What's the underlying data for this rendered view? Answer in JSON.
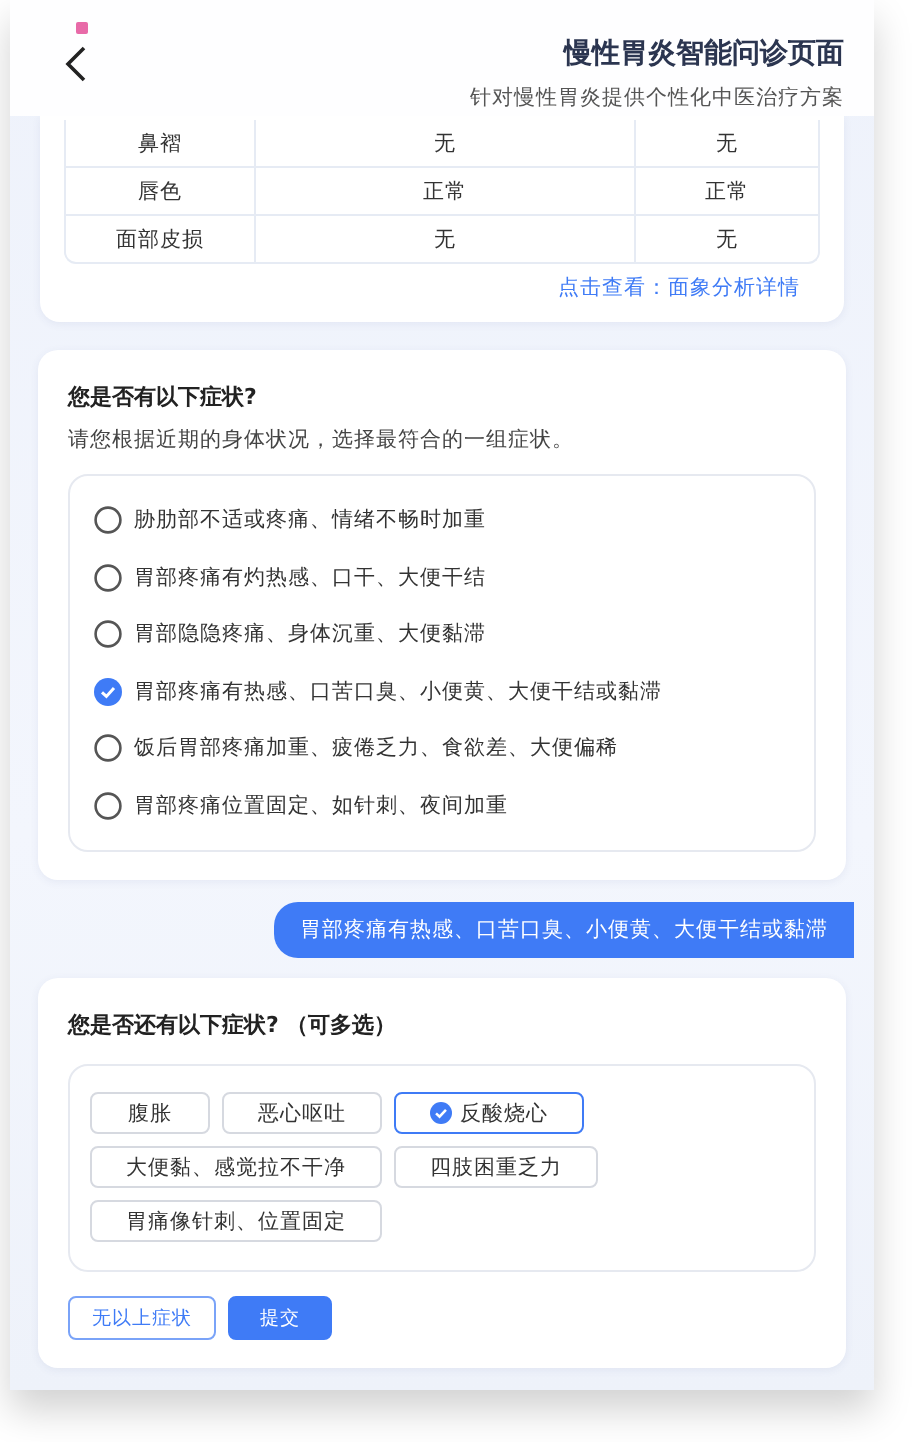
{
  "header": {
    "title": "慢性胃炎智能问诊页面",
    "subtitle": "针对慢性胃炎提供个性化中医治疗方案"
  },
  "face_table": {
    "rows": [
      [
        "鼻褶",
        "无",
        "无"
      ],
      [
        "唇色",
        "正常",
        "正常"
      ],
      [
        "面部皮损",
        "无",
        "无"
      ]
    ],
    "link": "点击查看：面象分析详情"
  },
  "question": {
    "title": "您是否有以下症状?",
    "hint": "请您根据近期的身体状况，选择最符合的一组症状。",
    "options": [
      {
        "label": "胁肋部不适或疼痛、情绪不畅时加重",
        "selected": false
      },
      {
        "label": "胃部疼痛有灼热感、口干、大便干结",
        "selected": false
      },
      {
        "label": "胃部隐隐疼痛、身体沉重、大便黏滞",
        "selected": false
      },
      {
        "label": "胃部疼痛有热感、口苦口臭、小便黄、大便干结或黏滞",
        "selected": true
      },
      {
        "label": "饭后胃部疼痛加重、疲倦乏力、食欲差、大便偏稀",
        "selected": false
      },
      {
        "label": "胃部疼痛位置固定、如针刺、夜间加重",
        "selected": false
      }
    ]
  },
  "reply": "胃部疼痛有热感、口苦口臭、小便黄、大便干结或黏滞",
  "followup": {
    "title": "您是否还有以下症状? （可多选）",
    "tags": [
      {
        "label": "腹胀",
        "selected": false
      },
      {
        "label": "恶心呕吐",
        "selected": false
      },
      {
        "label": "反酸烧心",
        "selected": true
      },
      {
        "label": "大便黏、感觉拉不干净",
        "selected": false
      },
      {
        "label": "四肢困重乏力",
        "selected": false
      },
      {
        "label": "胃痛像针刺、位置固定",
        "selected": false
      }
    ],
    "buttons": [
      {
        "label": "无以上症状",
        "kind": "outline"
      },
      {
        "label": "提交",
        "kind": "primary"
      }
    ]
  }
}
